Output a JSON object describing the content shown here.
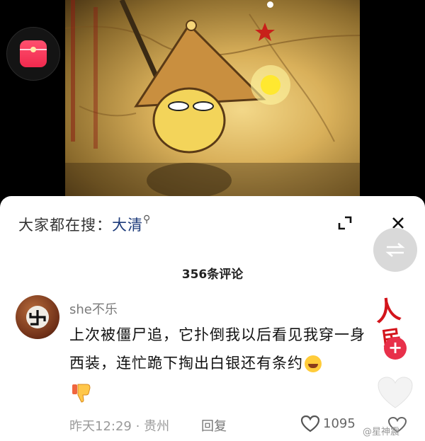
{
  "search": {
    "prefix": "大家都在搜：",
    "keyword": "大清",
    "icon": "search-icon"
  },
  "comments": {
    "count_label": "356条评论"
  },
  "comment": {
    "username": "she不乐",
    "text": "上次被僵尸追，它扑倒我以后看见我穿一身西装，连忙跪下掏出白银还有条约",
    "time": "昨天12:29",
    "separator": "·",
    "location": "贵州",
    "reply_label": "回复",
    "likes": "1095"
  },
  "overlay": {
    "stamp_char1": "人",
    "stamp_char2": "民",
    "plus": "+",
    "watermark": "@星神震"
  },
  "colors": {
    "keyword": "#1c3a7a",
    "accent_red": "#e8304a",
    "sheet_bg": "#ffffff"
  },
  "icons": [
    "red-packet-icon",
    "expand-icon",
    "close-icon",
    "swap-icon",
    "thumb-down-icon",
    "heart-icon",
    "laugh-emoji"
  ]
}
